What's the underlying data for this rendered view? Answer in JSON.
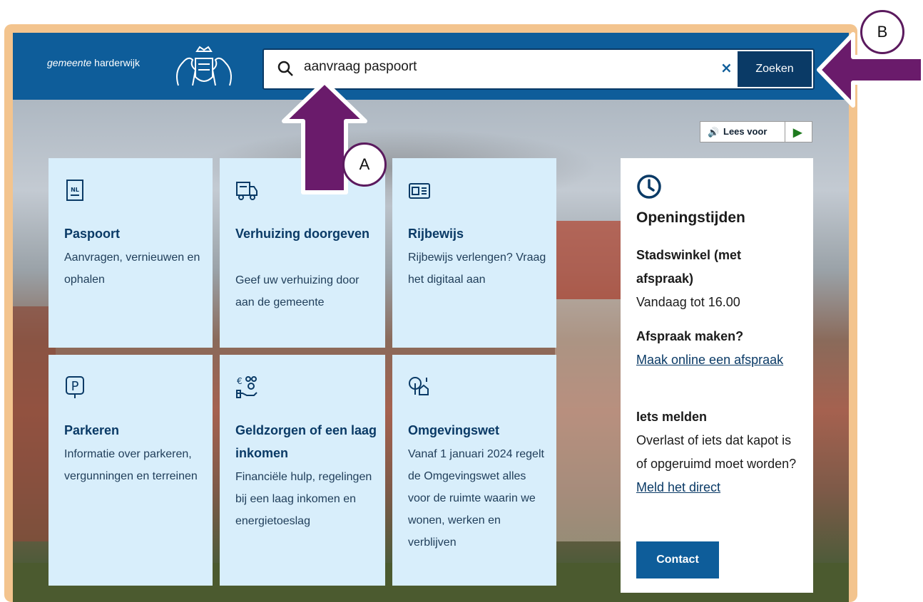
{
  "header": {
    "logo_italic": "gemeente",
    "logo_text": "harderwijk",
    "search_value": "aanvraag paspoort",
    "clear_label": "×",
    "search_button": "Zoeken"
  },
  "read_aloud": {
    "label": "Lees voor"
  },
  "cards": [
    {
      "title": "Paspoort",
      "description": "Aanvragen, vernieuwen en ophalen",
      "icon": "passport-icon"
    },
    {
      "title": "Verhuizing doorgeven",
      "description": "Geef uw verhuizing door aan de gemeente",
      "icon": "moving-truck-icon"
    },
    {
      "title": "Rijbewijs",
      "description": "Rijbewijs verlengen? Vraag het digitaal aan",
      "icon": "drivers-license-icon"
    },
    {
      "title": "Parkeren",
      "description": "Informatie over parkeren, vergunningen en terreinen",
      "icon": "parking-icon"
    },
    {
      "title": "Geldzorgen of een laag inkomen",
      "description": "Financiële hulp, regelingen bij een laag inkomen en energietoeslag",
      "icon": "money-help-icon"
    },
    {
      "title": "Omgevingswet",
      "description": "Vanaf 1 januari 2024 regelt de Omgevingswet alles voor de ruimte waarin we wonen, werken en verblijven",
      "icon": "environment-law-icon"
    }
  ],
  "hours_panel": {
    "heading": "Openingstijden",
    "location": "Stadswinkel (met afspraak)",
    "today": "Vandaag tot 16.00",
    "appointment_heading": "Afspraak maken?",
    "appointment_link": "Maak online een afspraak",
    "report_heading": "Iets melden",
    "report_text": "Overlast of iets dat kapot is of opgeruimd moet worden?",
    "report_link": "Meld het direct",
    "contact_button": "Contact"
  },
  "annotations": {
    "a_label": "A",
    "b_label": "B",
    "arrow_color": "#6a1b6b"
  },
  "colors": {
    "header_blue": "#0e5d9a",
    "dark_blue": "#0a3a66",
    "card_bg": "#d8eefb",
    "frame": "#f3c48e"
  }
}
